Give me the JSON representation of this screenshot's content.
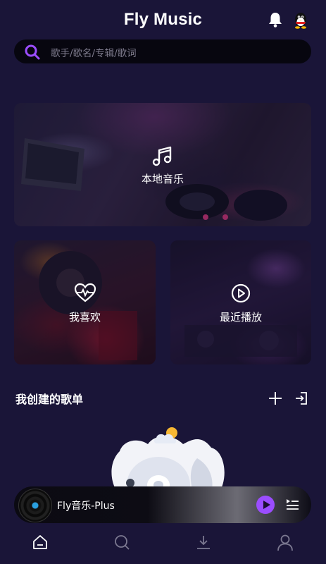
{
  "header": {
    "title": "Fly Music",
    "icons": [
      "bell-icon",
      "qq-penguin-icon"
    ]
  },
  "search": {
    "placeholder": "歌手/歌名/专辑/歌词",
    "icon": "search-icon",
    "accent": "#9b4dff"
  },
  "cards": [
    {
      "label": "本地音乐",
      "icon": "music-note-icon"
    },
    {
      "label": "我喜欢",
      "icon": "heart-pulse-icon"
    },
    {
      "label": "最近播放",
      "icon": "play-circle-icon"
    }
  ],
  "playlists": {
    "title": "我创建的歌单",
    "actions": [
      "plus-icon",
      "import-icon"
    ]
  },
  "player": {
    "song": "Fly音乐-Plus",
    "play_color": "#9b4dff"
  },
  "tabs": [
    "home-icon",
    "search-icon",
    "download-icon",
    "user-icon"
  ],
  "colors": {
    "background": "#1a1538",
    "accent": "#9b4dff"
  }
}
